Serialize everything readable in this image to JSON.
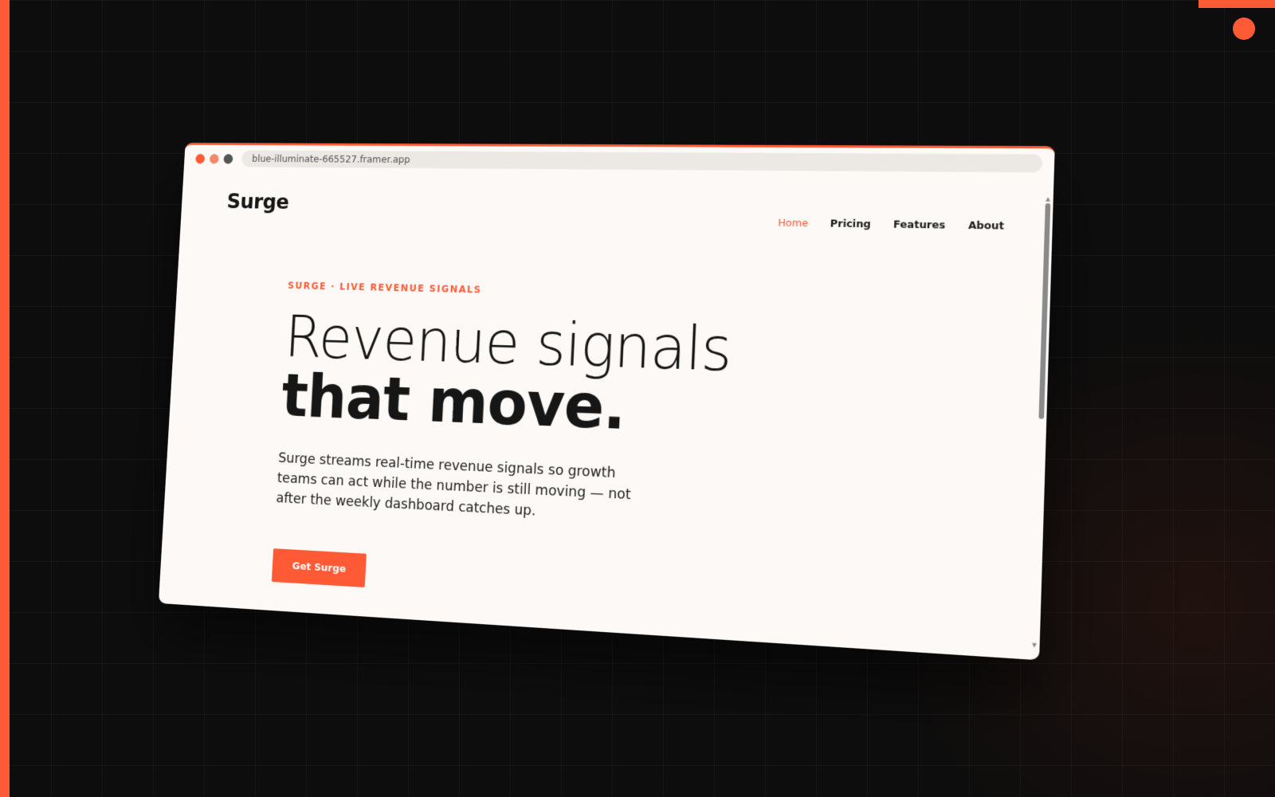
{
  "browser": {
    "url": "blue-illuminate-665527.framer.app"
  },
  "site": {
    "logo": "Surge",
    "nav": [
      {
        "label": "Home",
        "active": true
      },
      {
        "label": "Pricing",
        "active": false
      },
      {
        "label": "Features",
        "active": false
      },
      {
        "label": "About",
        "active": false
      }
    ]
  },
  "hero": {
    "eyebrow": "SURGE · LIVE REVENUE SIGNALS",
    "headline_line1": "Revenue signals",
    "headline_line2": "that move.",
    "subtext": "Surge streams real-time revenue signals so growth teams can act while the number is still moving — not after the weekly dashboard catches up.",
    "cta_label": "Get Surge"
  },
  "colors": {
    "accent": "#ff5a36",
    "background": "#0d0d0d",
    "page": "#fcf9f6",
    "text": "#161616"
  },
  "icons": {
    "scroll_up": "triangle-up-icon",
    "scroll_down": "triangle-down-icon"
  }
}
